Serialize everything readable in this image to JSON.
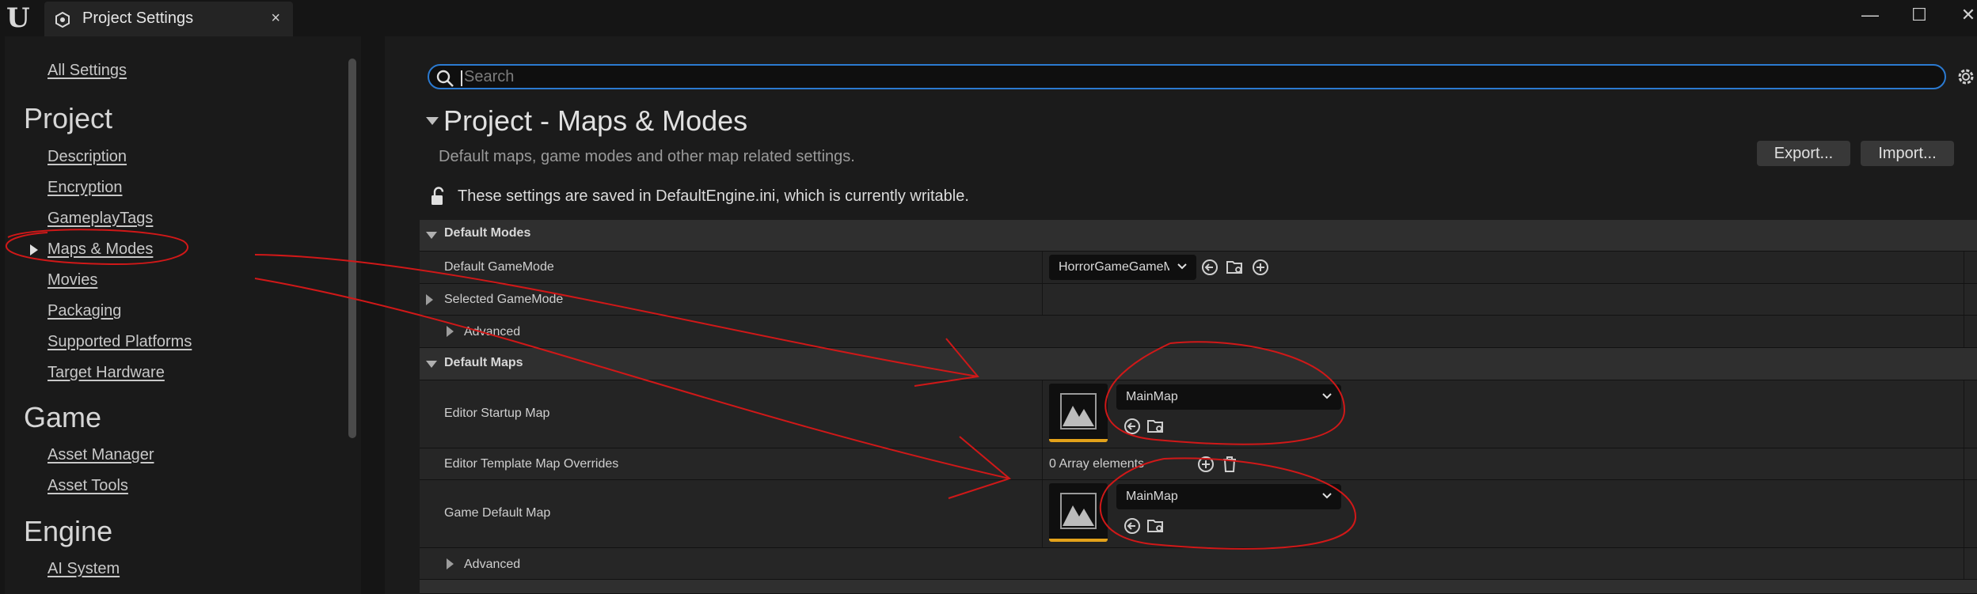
{
  "window": {
    "tab_title": "Project Settings",
    "tab_close": "×",
    "minimize": "—",
    "maximize": "☐",
    "close": "✕"
  },
  "nav": {
    "all_settings": "All Settings",
    "sections": [
      {
        "heading": "Project",
        "items": [
          "Description",
          "Encryption",
          "GameplayTags",
          "Maps & Modes",
          "Movies",
          "Packaging",
          "Supported Platforms",
          "Target Hardware"
        ]
      },
      {
        "heading": "Game",
        "items": [
          "Asset Manager",
          "Asset Tools"
        ]
      },
      {
        "heading": "Engine",
        "items": [
          "AI System"
        ]
      }
    ],
    "selected_item": "Maps & Modes"
  },
  "search": {
    "placeholder": "Search",
    "value": ""
  },
  "page": {
    "title": "Project - Maps & Modes",
    "description": "Default maps, game modes and other map related settings.",
    "export_label": "Export...",
    "import_label": "Import...",
    "saved_note": "These settings are saved in DefaultEngine.ini, which is currently writable."
  },
  "details": {
    "default_modes": {
      "header": "Default Modes",
      "default_gamemode_label": "Default GameMode",
      "default_gamemode_value": "HorrorGameGameMode",
      "selected_gamemode_label": "Selected GameMode",
      "advanced_label": "Advanced"
    },
    "default_maps": {
      "header": "Default Maps",
      "editor_startup_label": "Editor Startup Map",
      "editor_startup_value": "MainMap",
      "template_overrides_label": "Editor Template Map Overrides",
      "template_overrides_value": "0 Array elements",
      "game_default_label": "Game Default Map",
      "game_default_value": "MainMap",
      "advanced_label": "Advanced"
    }
  },
  "colors": {
    "accent_blue": "#2b7ad1",
    "asset_underline": "#e3a21a",
    "annotation_red": "#d01818"
  }
}
